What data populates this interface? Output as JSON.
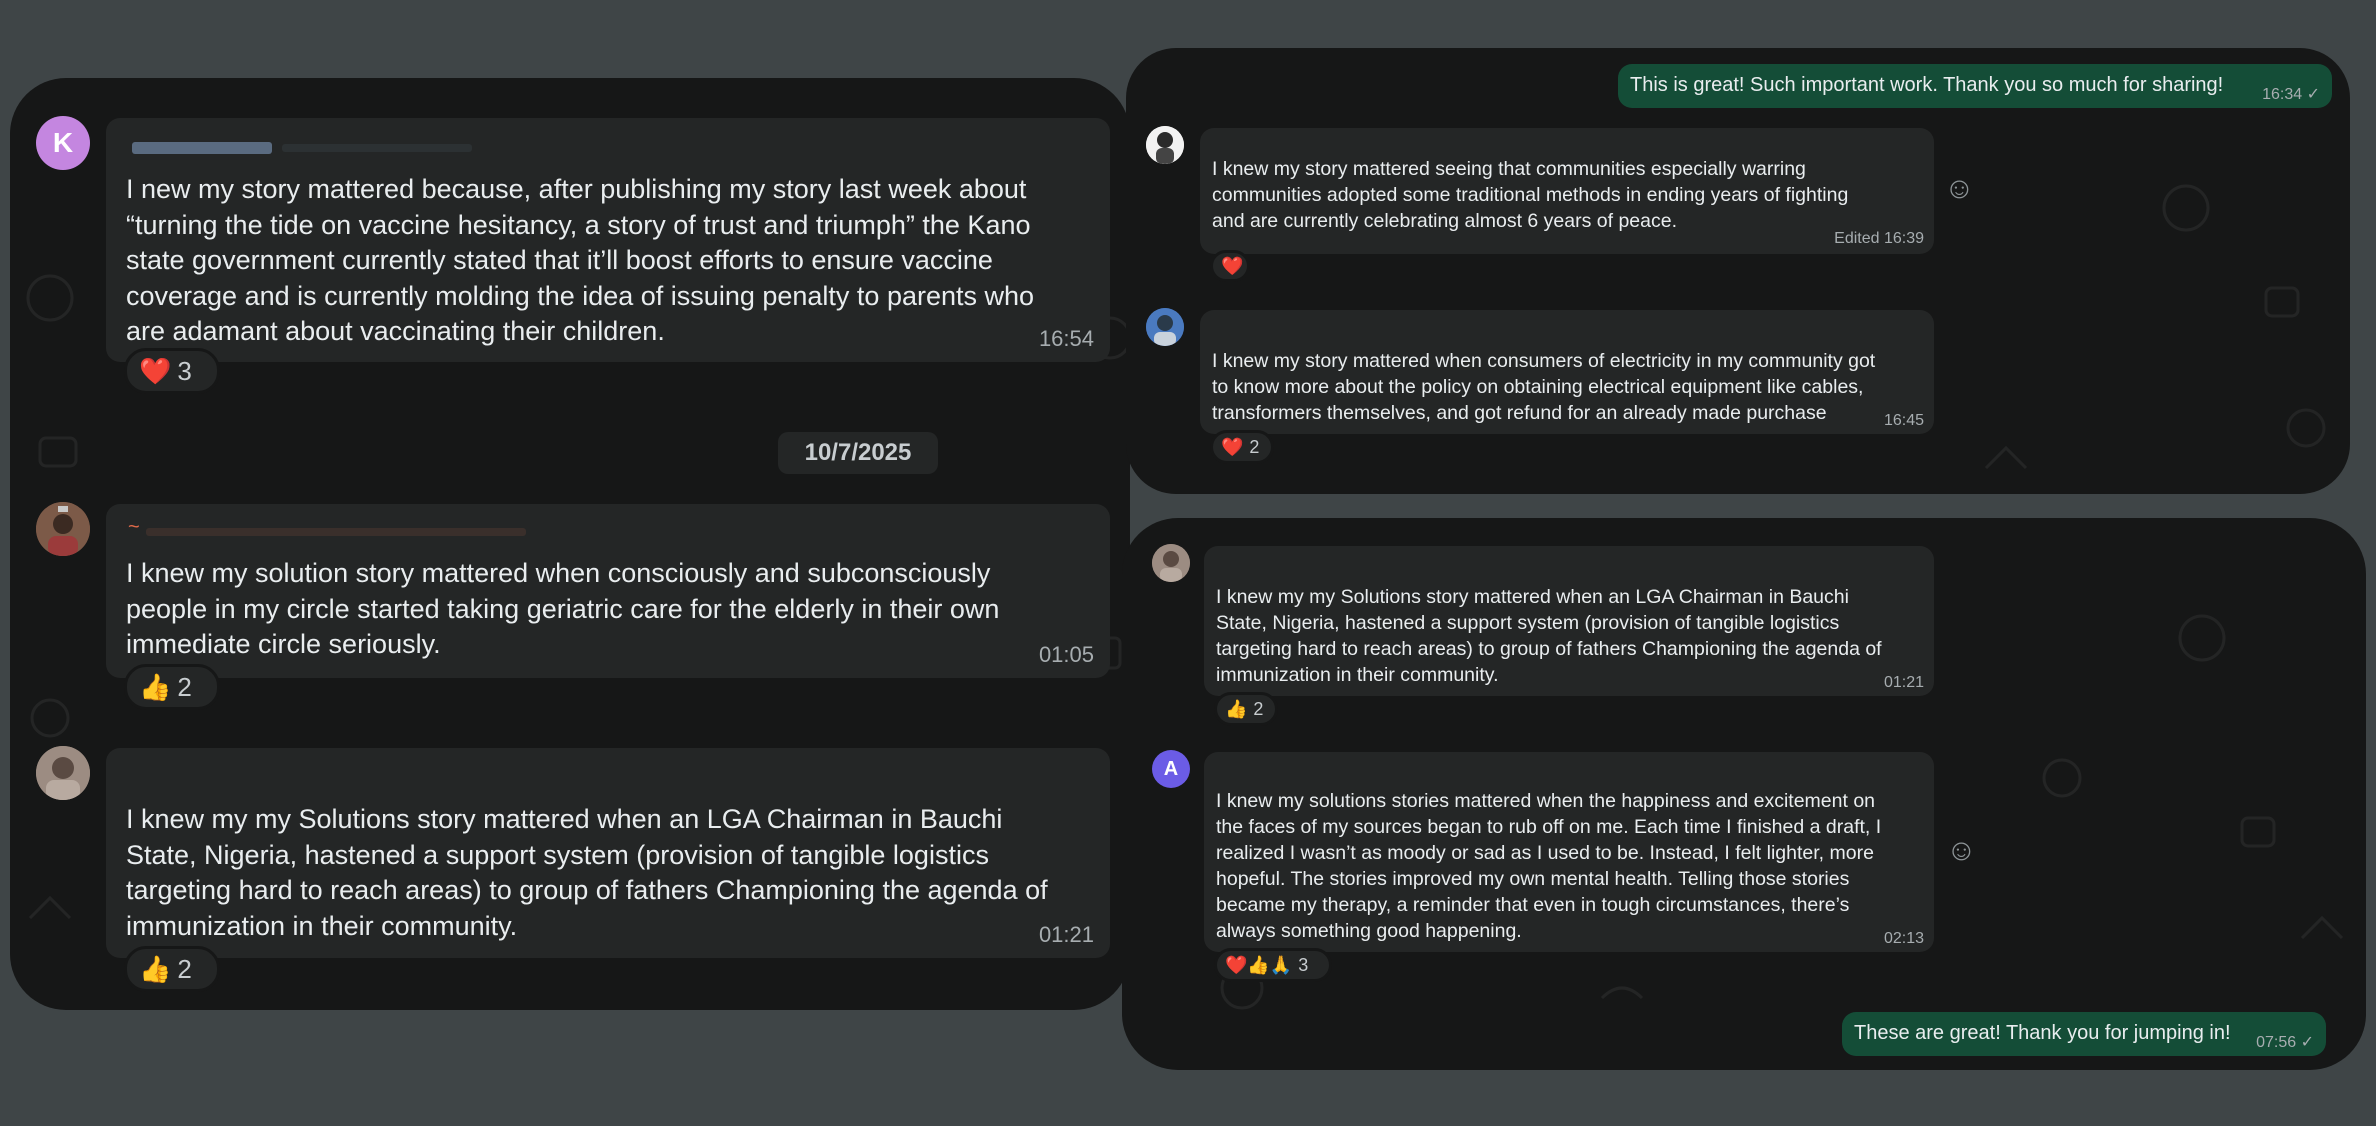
{
  "left": {
    "messages": [
      {
        "avatar_letter": "K",
        "text": "I new my story mattered because, after publishing my story last week about\n“turning the tide on vaccine hesitancy, a story of trust and triumph” the Kano\nstate government currently stated that it’ll boost efforts to ensure vaccine\ncoverage and is currently molding the idea of issuing penalty to parents who\nare adamant about vaccinating their children.",
        "time": "16:54",
        "reaction_emoji": "❤️",
        "reaction_count": "3"
      },
      {
        "name_prefix": "~",
        "text": "I knew my solution story mattered when consciously and subconsciously\npeople in my circle started taking geriatric care for the elderly in their own\nimmediate circle seriously.",
        "time": "01:05",
        "reaction_emoji": "👍",
        "reaction_count": "2"
      },
      {
        "text": "I knew my my Solutions story mattered when an LGA Chairman in Bauchi\nState, Nigeria, hastened a support system (provision of tangible logistics\ntargeting hard to reach areas) to group of fathers Championing the agenda of\nimmunization in their community.",
        "time": "01:21",
        "reaction_emoji": "👍",
        "reaction_count": "2"
      }
    ],
    "date_separator": "10/7/2025"
  },
  "top_right": {
    "outgoing": {
      "text": "This is great! Such important work. Thank you so much for sharing!",
      "time": "16:34"
    },
    "messages": [
      {
        "text": "I knew my story mattered seeing that communities especially warring\ncommunities adopted some traditional methods in ending years of fighting\nand are currently celebrating almost 6 years of peace.",
        "time": "Edited 16:39",
        "reaction_emoji": "❤️",
        "reaction_count": ""
      },
      {
        "text": "I knew my story mattered when consumers of electricity in my community got\nto know more about the policy on obtaining electrical equipment like cables,\ntransformers themselves, and got refund for an already made purchase",
        "time": "16:45",
        "reaction_emoji": "❤️",
        "reaction_count": "2"
      }
    ]
  },
  "bottom_right": {
    "messages": [
      {
        "text": "I knew my my Solutions story mattered when an LGA Chairman in Bauchi\nState, Nigeria, hastened a support system (provision of tangible logistics\ntargeting hard to reach areas) to group of fathers Championing the agenda of\nimmunization in their community.",
        "time": "01:21",
        "reaction_emoji": "👍",
        "reaction_count": "2"
      },
      {
        "avatar_letter": "A",
        "text": "I knew my solutions stories mattered when the happiness and excitement on\nthe faces of my sources began to rub off on me. Each time I finished a draft, I\nrealized I wasn’t as moody or sad as I used to be. Instead, I felt lighter, more\nhopeful. The stories improved my own mental health. Telling those stories\nbecame my therapy, a reminder that even in tough circumstances, there’s\nalways something good happening.",
        "time": "02:13",
        "reaction_emoji": "❤️👍🙏",
        "reaction_count": "3"
      }
    ],
    "outgoing": {
      "text": "These are great! Thank you for jumping in!",
      "time": "07:56"
    }
  },
  "icons": {
    "check": "✓",
    "smiley": "☺"
  },
  "colors": {
    "page_bg": "#3f4547",
    "panel_bg": "#161717",
    "incoming_bubble": "#242626",
    "outgoing_bubble": "#144d37",
    "avatar_k": "#c486e0",
    "avatar_a": "#6b5ce6"
  }
}
